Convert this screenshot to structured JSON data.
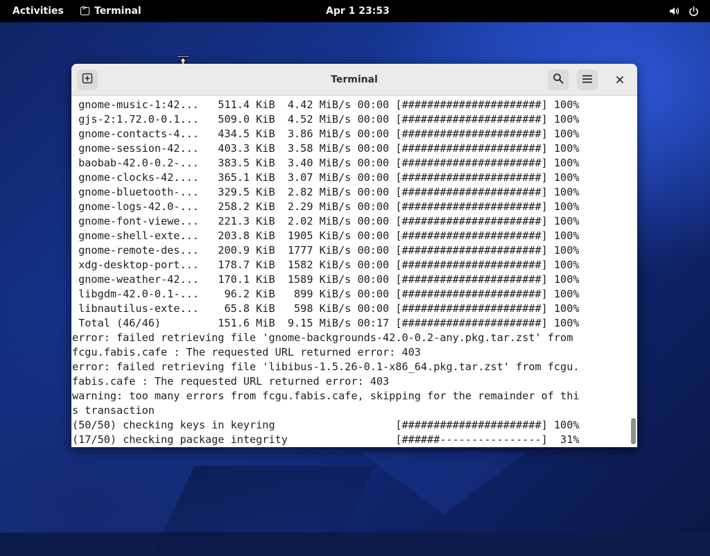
{
  "topbar": {
    "activities": "Activities",
    "app_name": "Terminal",
    "clock": "Apr 1  23:53"
  },
  "window": {
    "title": "Terminal"
  },
  "terminal": {
    "lines": [
      " gnome-music-1:42...   511.4 KiB  4.42 MiB/s 00:00 [######################] 100%",
      " gjs-2:1.72.0-0.1...   509.0 KiB  4.52 MiB/s 00:00 [######################] 100%",
      " gnome-contacts-4...   434.5 KiB  3.86 MiB/s 00:00 [######################] 100%",
      " gnome-session-42...   403.3 KiB  3.58 MiB/s 00:00 [######################] 100%",
      " baobab-42.0-0.2-...   383.5 KiB  3.40 MiB/s 00:00 [######################] 100%",
      " gnome-clocks-42....   365.1 KiB  3.07 MiB/s 00:00 [######################] 100%",
      " gnome-bluetooth-...   329.5 KiB  2.82 MiB/s 00:00 [######################] 100%",
      " gnome-logs-42.0-...   258.2 KiB  2.29 MiB/s 00:00 [######################] 100%",
      " gnome-font-viewe...   221.3 KiB  2.02 MiB/s 00:00 [######################] 100%",
      " gnome-shell-exte...   203.8 KiB  1905 KiB/s 00:00 [######################] 100%",
      " gnome-remote-des...   200.9 KiB  1777 KiB/s 00:00 [######################] 100%",
      " xdg-desktop-port...   178.7 KiB  1582 KiB/s 00:00 [######################] 100%",
      " gnome-weather-42...   170.1 KiB  1589 KiB/s 00:00 [######################] 100%",
      " libgdm-42.0-0.1-...    96.2 KiB   899 KiB/s 00:00 [######################] 100%",
      " libnautilus-exte...    65.8 KiB   598 KiB/s 00:00 [######################] 100%",
      " Total (46/46)         151.6 MiB  9.15 MiB/s 00:17 [######################] 100%",
      "error: failed retrieving file 'gnome-backgrounds-42.0-0.2-any.pkg.tar.zst' from",
      "fcgu.fabis.cafe : The requested URL returned error: 403",
      "error: failed retrieving file 'libibus-1.5.26-0.1-x86_64.pkg.tar.zst' from fcgu.",
      "fabis.cafe : The requested URL returned error: 403",
      "warning: too many errors from fcgu.fabis.cafe, skipping for the remainder of thi",
      "s transaction",
      "(50/50) checking keys in keyring                   [######################] 100%",
      "(17/50) checking package integrity                 [######----------------]  31%"
    ]
  },
  "icons": {
    "new_tab": "new-tab-icon",
    "search": "search-icon",
    "menu": "hamburger-menu-icon",
    "close": "close-icon",
    "volume": "volume-icon",
    "power": "power-icon"
  }
}
